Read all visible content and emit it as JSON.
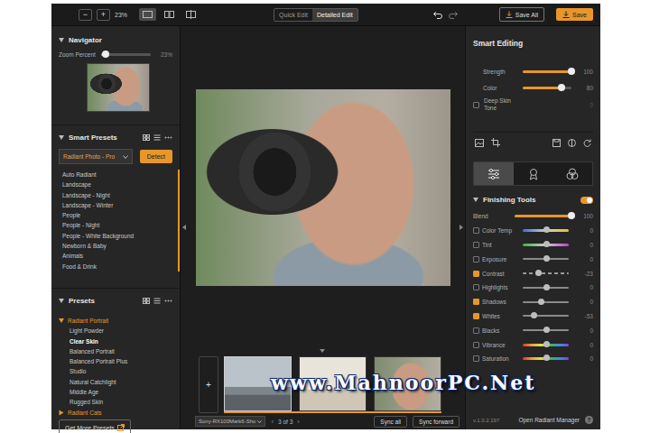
{
  "toolbar": {
    "zoom_out": "−",
    "zoom_in": "+",
    "zoom": "23%",
    "view_modes": [
      {
        "selected": true
      },
      {
        "selected": false
      },
      {
        "selected": false
      }
    ],
    "edit_tabs": [
      {
        "label": "Quick Edit",
        "selected": false
      },
      {
        "label": "Detailed Edit",
        "selected": true
      }
    ],
    "save_all": "Save All",
    "save": "Save"
  },
  "navigator": {
    "title": "Navigator",
    "expanded": true,
    "zoom_label": "Zoom Percent",
    "zoom_level": 0.1,
    "zoom_reading": "23%"
  },
  "smart_presets": {
    "title": "Smart Presets",
    "expanded": true,
    "dropdown": "Radiant Photo - Pro",
    "detect": "Detect",
    "items": [
      "Auto Radiant",
      "Landscape",
      "Landscape - Night",
      "Landscape - Winter",
      "People",
      "People - Night",
      "People - White Background",
      "Newborn & Baby",
      "Animals",
      "Food & Drink"
    ]
  },
  "presets": {
    "title": "Presets",
    "expanded": true,
    "groups": [
      {
        "label": "Radiant Portrait",
        "expanded": true,
        "items": [
          {
            "label": "Light Powder",
            "selected": false
          },
          {
            "label": "Clear Skin",
            "selected": true
          },
          {
            "label": "Balanced Portrait",
            "selected": false
          },
          {
            "label": "Balanced Portrait Plus",
            "selected": false
          },
          {
            "label": "Studio",
            "selected": false
          },
          {
            "label": "Natural Catchlight",
            "selected": false
          },
          {
            "label": "Middle Age",
            "selected": false
          },
          {
            "label": "Rugged Skin",
            "selected": false
          }
        ]
      },
      {
        "label": "Radiant Cats",
        "expanded": false,
        "items": []
      }
    ],
    "more": "Get More Presets"
  },
  "filmstrip": {
    "add": "+",
    "thumbs": [
      {
        "selected": true
      },
      {
        "selected": false
      },
      {
        "selected": false
      }
    ],
    "camera": "Sony-RX100Mark6-Sho",
    "prev": "‹",
    "count": "3 of 3",
    "next": "›",
    "sync_all": "Sync all",
    "sync_forward": "Sync forward"
  },
  "smart_editing": {
    "title": "Smart Editing",
    "sliders": [
      {
        "label": "Strength",
        "level": 1,
        "reading": "100"
      },
      {
        "label": "Color",
        "level": 0.8,
        "reading": "80"
      }
    ],
    "deep_skin": {
      "label": "Deep Skin Tone",
      "checked": false,
      "reading": "0"
    }
  },
  "tool_tabs": [
    {
      "selected": true
    },
    {
      "selected": false
    },
    {
      "selected": false
    }
  ],
  "finishing": {
    "title": "Finishing Tools",
    "on": true,
    "blend": {
      "label": "Blend",
      "level": 1,
      "reading": "100"
    },
    "rows": [
      {
        "label": "Color Temp",
        "kind": "temp",
        "checked": false,
        "level": 0.5,
        "reading": "0"
      },
      {
        "label": "Tint",
        "kind": "tint",
        "checked": false,
        "level": 0.5,
        "reading": "0"
      },
      {
        "label": "Exposure",
        "kind": "tone",
        "checked": false,
        "level": 0.5,
        "reading": "0"
      },
      {
        "label": "Contrast",
        "kind": "dashed",
        "checked": true,
        "level": 0.33,
        "reading": "-23"
      },
      {
        "label": "Highlights",
        "kind": "tone",
        "checked": false,
        "level": 0.5,
        "reading": "0"
      },
      {
        "label": "Shadows",
        "kind": "tone",
        "checked": true,
        "level": 0.4,
        "reading": "0"
      },
      {
        "label": "Whites",
        "kind": "tone",
        "checked": true,
        "level": 0.23,
        "reading": "-53"
      },
      {
        "label": "Blacks",
        "kind": "tone",
        "checked": false,
        "level": 0.5,
        "reading": "0"
      },
      {
        "label": "Vibrance",
        "kind": "spectrum",
        "checked": false,
        "level": 0.5,
        "reading": "0"
      },
      {
        "label": "Saturation",
        "kind": "spectrum",
        "checked": false,
        "level": 0.5,
        "reading": "0"
      }
    ]
  },
  "footer": {
    "version": "v.1.0.2.197",
    "manager": "Open Radiant Manager",
    "help": "?"
  },
  "watermark": "www.MahnoorPC.Net"
}
